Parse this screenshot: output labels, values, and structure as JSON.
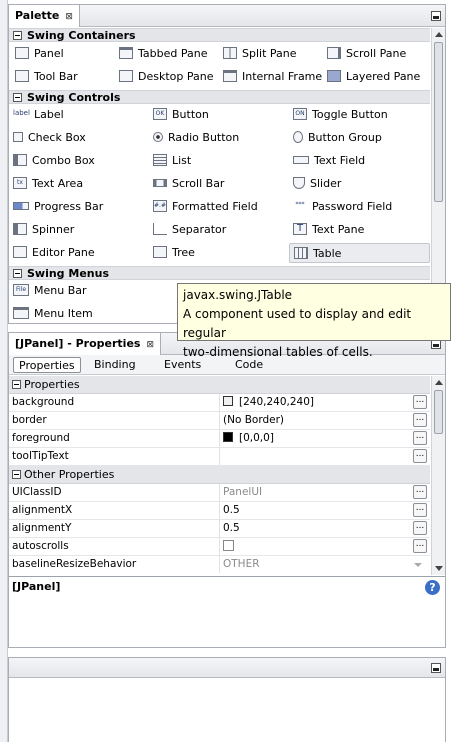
{
  "palette": {
    "tab_title": "Palette",
    "tab_close": "⊠",
    "categories": [
      {
        "label": "Swing Containers",
        "items": [
          "Panel",
          "Tabbed Pane",
          "Split Pane",
          "Scroll Pane",
          "Tool Bar",
          "Desktop Pane",
          "Internal Frame",
          "Layered Pane"
        ]
      },
      {
        "label": "Swing Controls",
        "items": [
          "Label",
          "Button",
          "Toggle Button",
          "Check Box",
          "Radio Button",
          "Button Group",
          "Combo Box",
          "List",
          "Text Field",
          "Text Area",
          "Scroll Bar",
          "Slider",
          "Progress Bar",
          "Formatted Field",
          "Password Field",
          "Spinner",
          "Separator",
          "Text Pane",
          "Editor Pane",
          "Tree",
          "Table"
        ]
      },
      {
        "label": "Swing Menus",
        "items": [
          "Menu Bar",
          "Menu Item"
        ]
      }
    ],
    "icon_glyphs": {
      "label": "label",
      "button": "OK",
      "toggle": "ON",
      "textarea": "tx",
      "formatted": "#.#",
      "password": "***",
      "textpane": "T",
      "menubar": "File"
    }
  },
  "tooltip": {
    "line1": "javax.swing.JTable",
    "line2": "A component used to display and edit regular",
    "line3": "two-dimensional tables of cells."
  },
  "properties": {
    "tab_title": "[JPanel] - Properties",
    "tab_close": "⊠",
    "subtabs": [
      "Properties",
      "Binding",
      "Events",
      "Code"
    ],
    "sections": [
      {
        "label": "Properties",
        "rows": [
          {
            "name": "background",
            "value": "[240,240,240]",
            "swatch": "#f0f0f0"
          },
          {
            "name": "border",
            "value": "(No Border)"
          },
          {
            "name": "foreground",
            "value": "[0,0,0]",
            "swatch": "#000000"
          },
          {
            "name": "toolTipText",
            "value": ""
          }
        ]
      },
      {
        "label": "Other Properties",
        "rows": [
          {
            "name": "UIClassID",
            "value": "PanelUI"
          },
          {
            "name": "alignmentX",
            "value": "0.5"
          },
          {
            "name": "alignmentY",
            "value": "0.5"
          },
          {
            "name": "autoscrolls",
            "value": ""
          },
          {
            "name": "baselineResizeBehavior",
            "value": "OTHER"
          }
        ]
      }
    ],
    "ellipsis": "...",
    "description_title": "[JPanel]",
    "help": "?"
  }
}
